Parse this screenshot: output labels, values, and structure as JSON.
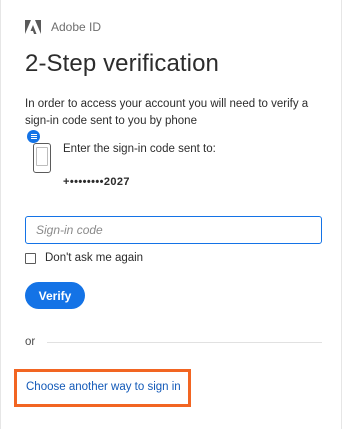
{
  "header": {
    "brand": "Adobe ID",
    "logo_icon": "adobe-logo-icon"
  },
  "page": {
    "title": "2-Step verification",
    "description": "In order to access your account you will need to verify a sign-in code sent to you by phone",
    "code_sent_label": "Enter the sign-in code sent to:",
    "phone_number": "+••••••••2027",
    "phone_icon": "phone-message-icon"
  },
  "form": {
    "code_placeholder": "Sign-in code",
    "code_value": "",
    "remember_label": "Don't ask me again",
    "remember_checked": false,
    "verify_label": "Verify"
  },
  "alternatives": {
    "or_label": "or",
    "link_label": "Choose another way to sign in"
  },
  "colors": {
    "accent": "#1473e6",
    "link": "#1259b8",
    "highlight": "#f26522"
  }
}
